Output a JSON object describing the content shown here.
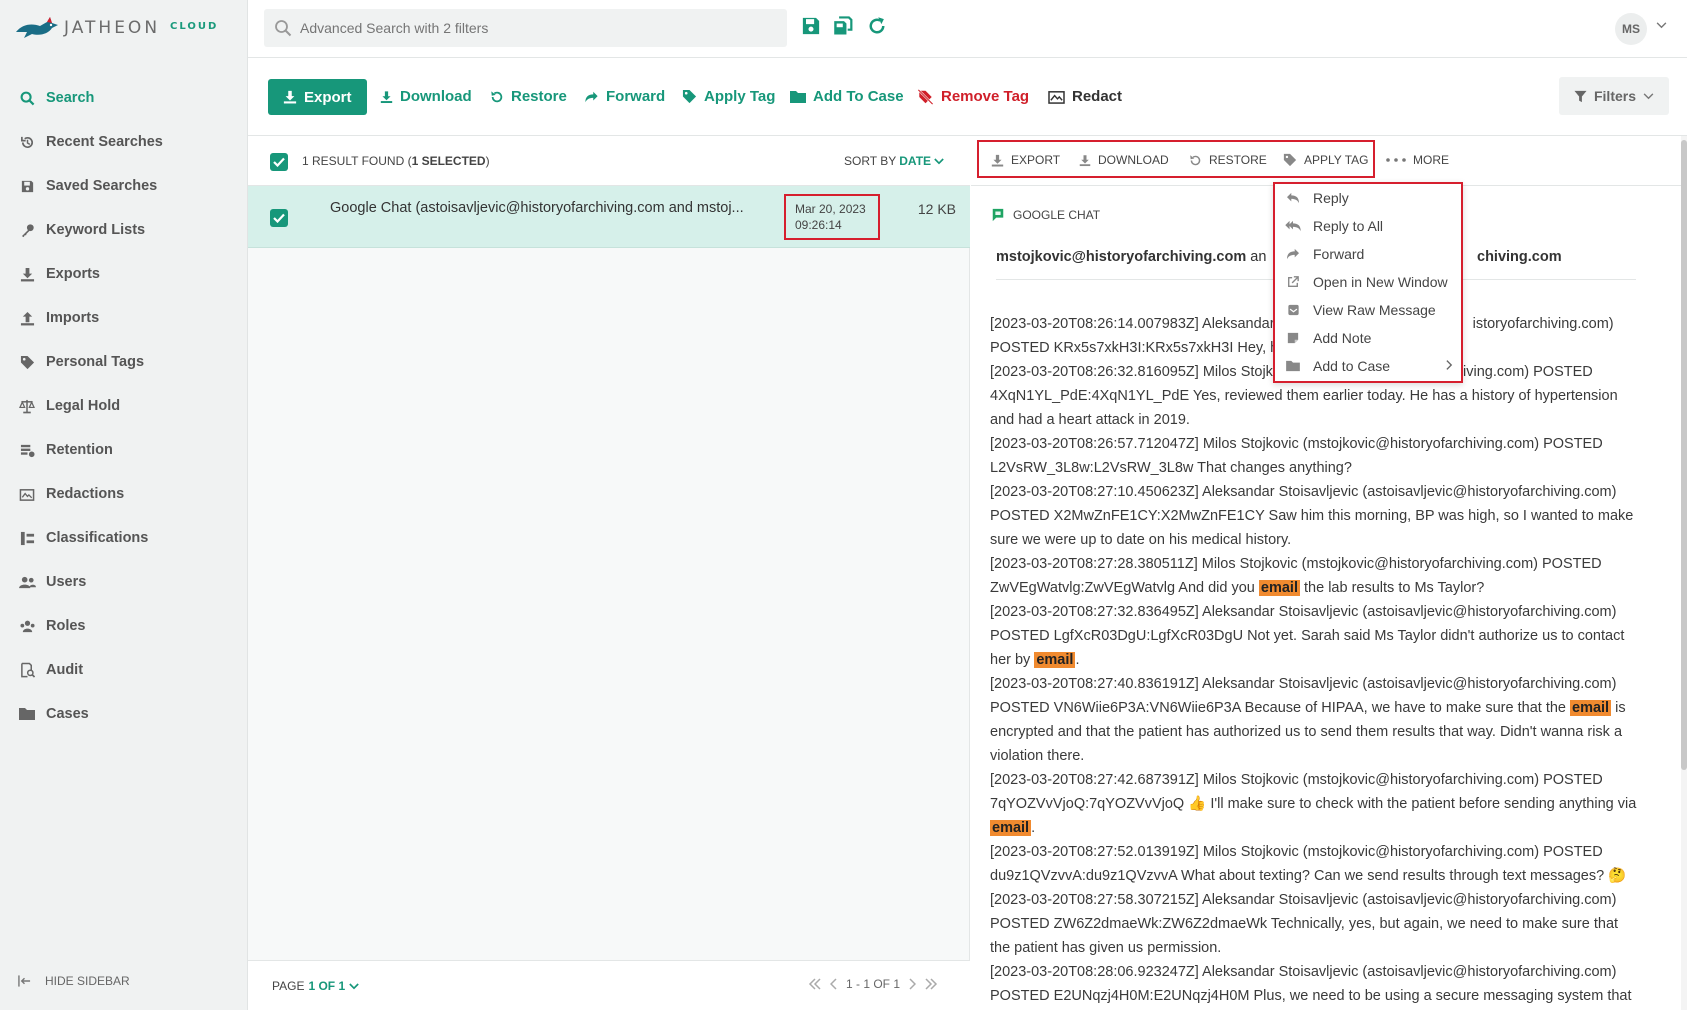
{
  "app": {
    "logo_text": "JATHEON",
    "logo_cloud": "CLOUD",
    "brand_color": "#17977a",
    "danger_color": "#d0202a"
  },
  "sidebar": {
    "items": [
      {
        "label": "Search",
        "icon": "search-icon"
      },
      {
        "label": "Recent Searches",
        "icon": "history-icon"
      },
      {
        "label": "Saved Searches",
        "icon": "save-icon"
      },
      {
        "label": "Keyword Lists",
        "icon": "key-icon"
      },
      {
        "label": "Exports",
        "icon": "export-icon"
      },
      {
        "label": "Imports",
        "icon": "import-icon"
      },
      {
        "label": "Personal Tags",
        "icon": "tag-icon"
      },
      {
        "label": "Legal Hold",
        "icon": "scale-icon"
      },
      {
        "label": "Retention",
        "icon": "retention-icon"
      },
      {
        "label": "Redactions",
        "icon": "redaction-icon"
      },
      {
        "label": "Classifications",
        "icon": "classification-icon"
      },
      {
        "label": "Users",
        "icon": "users-icon"
      },
      {
        "label": "Roles",
        "icon": "roles-icon"
      },
      {
        "label": "Audit",
        "icon": "audit-icon"
      },
      {
        "label": "Cases",
        "icon": "folder-icon"
      }
    ],
    "hide_label": "HIDE SIDEBAR"
  },
  "topbar": {
    "search_placeholder": "Advanced Search with 2 filters",
    "avatar_initials": "MS"
  },
  "actions": {
    "export": "Export",
    "download": "Download",
    "restore": "Restore",
    "forward": "Forward",
    "apply_tag": "Apply Tag",
    "add_to_case": "Add To Case",
    "remove_tag": "Remove Tag",
    "redact": "Redact",
    "filters": "Filters"
  },
  "results": {
    "count_prefix": "1 RESULT FOUND (",
    "count_selected": "1 SELECTED",
    "count_suffix": ")",
    "sort_label": "SORT BY",
    "sort_value": "DATE",
    "row": {
      "title": "Google Chat (astoisavljevic@historyofarchiving.com and mstoj...",
      "date_line1": "Mar 20, 2023",
      "date_line2": "09:26:14",
      "size": "12 KB"
    },
    "pager": {
      "page_label": "PAGE",
      "page_value": "1 OF 1",
      "range": "1 - 1 OF 1"
    }
  },
  "preview": {
    "toolbar": {
      "export": "EXPORT",
      "download": "DOWNLOAD",
      "restore": "RESTORE",
      "apply_tag": "APPLY TAG",
      "more": "MORE"
    },
    "type_label": "GOOGLE CHAT",
    "from_left": "mstojkovic@historyofarchiving.com",
    "from_and": "an",
    "from_right": "chiving.com",
    "messages": [
      {
        "parts": [
          "[2023-03-20T08:26:14.007983Z] Aleksandar",
          "                                   istoryofarchiving.com)"
        ],
        "p2": "POSTED KRx5s7xkH3I:KRx5s7xkH3I Hey, ha                                         yet?"
      },
      {
        "parts": [
          "[2023-03-20T08:26:32.816095Z] Milos Stojk",
          "                                   hiving.com) POSTED"
        ],
        "p2": "4XqN1YL_PdE:4XqN1YL_PdE Yes, reviewed them earlier today. He has a history of hypertension and had a heart attack in 2019."
      },
      {
        "text": "[2023-03-20T08:26:57.712047Z] Milos Stojkovic (mstojkovic@historyofarchiving.com) POSTED L2VsRW_3L8w:L2VsRW_3L8w That changes anything?"
      },
      {
        "text": "[2023-03-20T08:27:10.450623Z] Aleksandar Stoisavljevic (astoisavljevic@historyofarchiving.com) POSTED X2MwZnFE1CY:X2MwZnFE1CY Saw him this morning, BP was high, so I wanted to make sure we were up to date on his medical history."
      },
      {
        "pre": "[2023-03-20T08:27:28.380511Z] Milos Stojkovic (mstojkovic@historyofarchiving.com) POSTED ZwVEgWatvlg:ZwVEgWatvlg And did you ",
        "hl": "email",
        "post": " the lab results to Ms Taylor?"
      },
      {
        "pre": "[2023-03-20T08:27:32.836495Z] Aleksandar Stoisavljevic (astoisavljevic@historyofarchiving.com) POSTED LgfXcR03DgU:LgfXcR03DgU Not yet. Sarah said Ms Taylor didn't authorize us to contact her by ",
        "hl": "email",
        "post": "."
      },
      {
        "pre": "[2023-03-20T08:27:40.836191Z] Aleksandar Stoisavljevic (astoisavljevic@historyofarchiving.com) POSTED VN6Wiie6P3A:VN6Wiie6P3A Because of HIPAA, we have to make sure that the ",
        "hl": "email",
        "post": " is encrypted and that the patient has authorized us to send them results that way. Didn't wanna risk a violation there."
      },
      {
        "pre": "[2023-03-20T08:27:42.687391Z] Milos Stojkovic (mstojkovic@historyofarchiving.com) POSTED 7qYOZVvVjoQ:7qYOZVvVjoQ 👍 I'll make sure to check with the patient before sending anything via ",
        "hl": "email",
        "post": "."
      },
      {
        "text": "[2023-03-20T08:27:52.013919Z] Milos Stojkovic (mstojkovic@historyofarchiving.com) POSTED du9z1QVzvvA:du9z1QVzvvA What about texting? Can we send results through text messages? 🤔"
      },
      {
        "text": "[2023-03-20T08:27:58.307215Z] Aleksandar Stoisavljevic (astoisavljevic@historyofarchiving.com) POSTED ZW6Z2dmaeWk:ZW6Z2dmaeWk Technically, yes, but again, we need to make sure that the patient has given us permission."
      },
      {
        "text": "[2023-03-20T08:28:06.923247Z] Aleksandar Stoisavljevic (astoisavljevic@historyofarchiving.com) POSTED E2UNqzj4H0M:E2UNqzj4H0M Plus, we need to be using a secure messaging system that is"
      }
    ]
  },
  "more_menu": {
    "items": [
      {
        "label": "Reply",
        "icon": "reply-icon"
      },
      {
        "label": "Reply to All",
        "icon": "reply-all-icon"
      },
      {
        "label": "Forward",
        "icon": "forward-icon"
      },
      {
        "label": "Open in New Window",
        "icon": "external-link-icon"
      },
      {
        "label": "View Raw Message",
        "icon": "raw-message-icon"
      },
      {
        "label": "Add Note",
        "icon": "note-icon"
      },
      {
        "label": "Add to Case",
        "icon": "folder-icon"
      }
    ]
  }
}
